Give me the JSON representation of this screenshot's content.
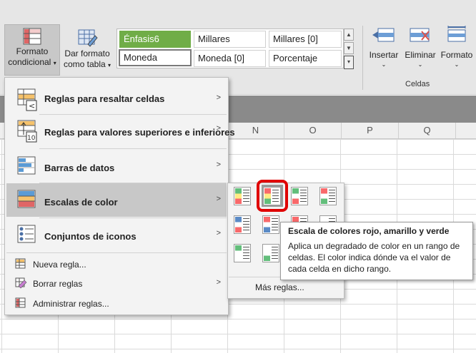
{
  "ribbon": {
    "formato_condicional": {
      "line1": "Formato",
      "line2": "condicional"
    },
    "dar_formato_tabla": {
      "line1": "Dar formato",
      "line2": "como tabla"
    },
    "styles": [
      {
        "label": "Énfasis6"
      },
      {
        "label": "Millares"
      },
      {
        "label": "Millares [0]"
      },
      {
        "label": "Moneda"
      },
      {
        "label": "Moneda [0]"
      },
      {
        "label": "Porcentaje"
      }
    ],
    "cells": {
      "insertar": "Insertar",
      "eliminar": "Eliminar",
      "formato": "Formato",
      "group_label": "Celdas"
    }
  },
  "columns": [
    "N",
    "O",
    "P",
    "Q"
  ],
  "menu": {
    "items": [
      {
        "label": "Reglas para resaltar celdas",
        "underline": "R"
      },
      {
        "label": "Reglas para valores superiores e inferiores",
        "underline": "R"
      },
      {
        "label": "Barras de datos",
        "underline": "B"
      },
      {
        "label": "Escalas de color",
        "underline": "E"
      },
      {
        "label": "Conjuntos de iconos",
        "underline": "C"
      }
    ],
    "small_items": [
      {
        "label": "Nueva regla...",
        "underline": "N"
      },
      {
        "label": "Borrar reglas",
        "underline": "B"
      },
      {
        "label": "Administrar reglas...",
        "underline": "A"
      }
    ]
  },
  "submenu": {
    "more_rules": "Más reglas..."
  },
  "tooltip": {
    "title": "Escala de colores rojo, amarillo y verde",
    "description": "Aplica un degradado de color en un rango de celdas. El color indica dónde va el valor de cada celda en dicho rango."
  },
  "colors": {
    "accent_green": "#70ad47",
    "highlight_red": "#e00000"
  }
}
